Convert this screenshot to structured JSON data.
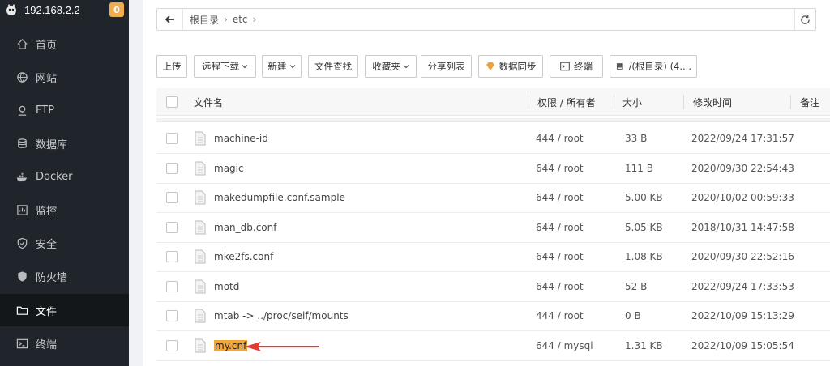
{
  "server": {
    "ip": "192.168.2.2",
    "badge": "0"
  },
  "sidebar": {
    "items": [
      {
        "label": "首页",
        "icon": "home-icon"
      },
      {
        "label": "网站",
        "icon": "globe-icon"
      },
      {
        "label": "FTP",
        "icon": "ftp-icon"
      },
      {
        "label": "数据库",
        "icon": "database-icon"
      },
      {
        "label": "Docker",
        "icon": "docker-icon"
      },
      {
        "label": "监控",
        "icon": "monitor-icon"
      },
      {
        "label": "安全",
        "icon": "shield-icon"
      },
      {
        "label": "防火墙",
        "icon": "firewall-icon"
      },
      {
        "label": "文件",
        "icon": "folder-icon",
        "active": true
      },
      {
        "label": "终端",
        "icon": "terminal-icon"
      }
    ]
  },
  "path": {
    "root": "根目录",
    "dir": "etc"
  },
  "toolbar": {
    "upload": "上传",
    "remote_download": "远程下载",
    "new": "新建",
    "file_search": "文件查找",
    "favorites": "收藏夹",
    "share_list": "分享列表",
    "data_sync": "数据同步",
    "terminal": "终端",
    "disk": "/(根目录) (4...."
  },
  "table": {
    "columns": {
      "name": "文件名",
      "perm": "权限 / 所有者",
      "size": "大小",
      "mtime": "修改时间",
      "note": "备注"
    },
    "rows": [
      {
        "name": "machine-id",
        "perm": "444 / root",
        "size": "33 B",
        "mtime": "2022/09/24 17:31:57"
      },
      {
        "name": "magic",
        "perm": "644 / root",
        "size": "111 B",
        "mtime": "2020/09/30 22:54:43"
      },
      {
        "name": "makedumpfile.conf.sample",
        "perm": "644 / root",
        "size": "5.00 KB",
        "mtime": "2020/10/02 00:59:33"
      },
      {
        "name": "man_db.conf",
        "perm": "644 / root",
        "size": "5.05 KB",
        "mtime": "2018/10/31 14:47:58"
      },
      {
        "name": "mke2fs.conf",
        "perm": "644 / root",
        "size": "1.08 KB",
        "mtime": "2020/09/30 22:52:16"
      },
      {
        "name": "motd",
        "perm": "644 / root",
        "size": "52 B",
        "mtime": "2022/09/24 17:33:53"
      },
      {
        "name": "mtab -> ../proc/self/mounts",
        "perm": "444 / root",
        "size": "0 B",
        "mtime": "2022/10/09 15:13:29"
      },
      {
        "name": "my.cnf",
        "perm": "644 / mysql",
        "size": "1.31 KB",
        "mtime": "2022/10/09 15:05:54",
        "highlighted": true
      }
    ]
  },
  "colors": {
    "sidebar_bg": "#20252b",
    "highlight": "#f2a73a",
    "arrow": "#e53935",
    "badge": "#f0ad4e"
  }
}
